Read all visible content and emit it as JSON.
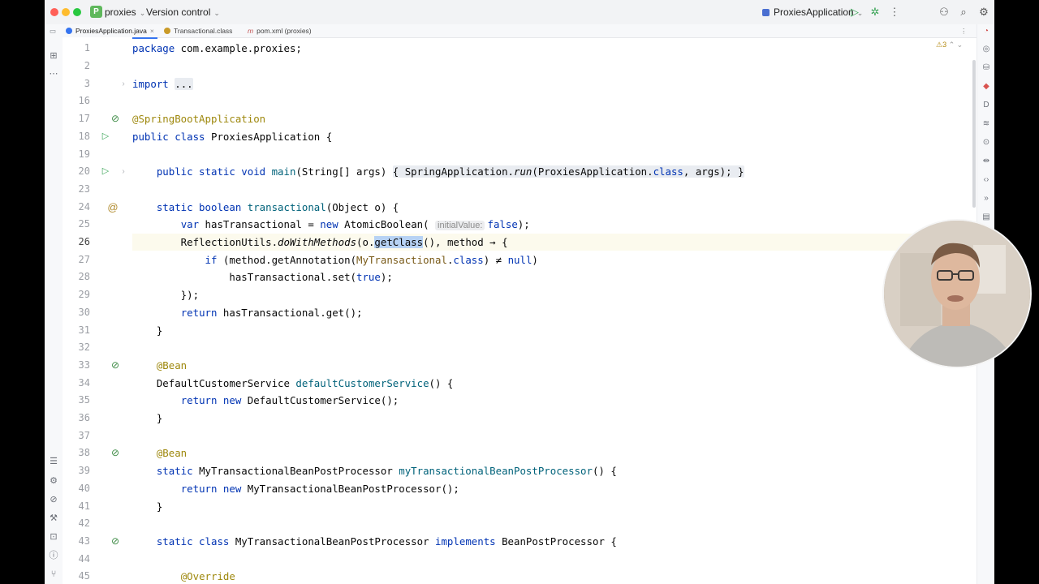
{
  "titlebar": {
    "project_badge": "P",
    "project_name": "proxies",
    "vcs_label": "Version control",
    "run_config": "ProxiesApplication",
    "icons": [
      "run-icon",
      "debug-icon",
      "more-icon",
      "account-icon",
      "search-icon",
      "settings-icon"
    ]
  },
  "tabs": [
    {
      "label": "ProxiesApplication.java",
      "active": true,
      "icon_color": "#3574f0"
    },
    {
      "label": "Transactional.class",
      "active": false,
      "icon_color": "#c99a28"
    },
    {
      "label": "pom.xml (proxies)",
      "active": false,
      "icon": "m"
    }
  ],
  "inspection": {
    "warnings": "3"
  },
  "code_lines": [
    {
      "num": "1",
      "text": "package com.example.proxies;"
    },
    {
      "num": "2",
      "text": ""
    },
    {
      "num": "3",
      "text": "import ..."
    },
    {
      "num": "16",
      "text": ""
    },
    {
      "num": "17",
      "text": "@SpringBootApplication"
    },
    {
      "num": "18",
      "text": "public class ProxiesApplication {"
    },
    {
      "num": "19",
      "text": ""
    },
    {
      "num": "20",
      "text": "    public static void main(String[] args) { SpringApplication.run(ProxiesApplication.class, args); }"
    },
    {
      "num": "23",
      "text": ""
    },
    {
      "num": "24",
      "text": "    static boolean transactional(Object o) {"
    },
    {
      "num": "25",
      "text": "        var hasTransactional = new AtomicBoolean( initialValue: false);"
    },
    {
      "num": "26",
      "text": "        ReflectionUtils.doWithMethods(o.getClass(), method → {"
    },
    {
      "num": "27",
      "text": "            if (method.getAnnotation(MyTransactional.class) ≠ null)"
    },
    {
      "num": "28",
      "text": "                hasTransactional.set(true);"
    },
    {
      "num": "29",
      "text": "        });"
    },
    {
      "num": "30",
      "text": "        return hasTransactional.get();"
    },
    {
      "num": "31",
      "text": "    }"
    },
    {
      "num": "32",
      "text": ""
    },
    {
      "num": "33",
      "text": "    @Bean"
    },
    {
      "num": "34",
      "text": "    DefaultCustomerService defaultCustomerService() {"
    },
    {
      "num": "35",
      "text": "        return new DefaultCustomerService();"
    },
    {
      "num": "36",
      "text": "    }"
    },
    {
      "num": "37",
      "text": ""
    },
    {
      "num": "38",
      "text": "    @Bean"
    },
    {
      "num": "39",
      "text": "    static MyTransactionalBeanPostProcessor myTransactionalBeanPostProcessor() {"
    },
    {
      "num": "40",
      "text": "        return new MyTransactionalBeanPostProcessor();"
    },
    {
      "num": "41",
      "text": "    }"
    },
    {
      "num": "42",
      "text": ""
    },
    {
      "num": "43",
      "text": "    static class MyTransactionalBeanPostProcessor implements BeanPostProcessor {"
    },
    {
      "num": "44",
      "text": ""
    },
    {
      "num": "45",
      "text": "        @Override"
    }
  ],
  "editor": {
    "current_line": "26",
    "selected_text": "getClass",
    "inlay_hint": "initialValue:"
  },
  "colors": {
    "keyword": "#0033b3",
    "annotation": "#9e880d",
    "method": "#00627a",
    "field": "#871094",
    "selection": "#b7d2f4",
    "run_icon": "#3ea65a"
  },
  "webcam": {
    "visible": true
  }
}
